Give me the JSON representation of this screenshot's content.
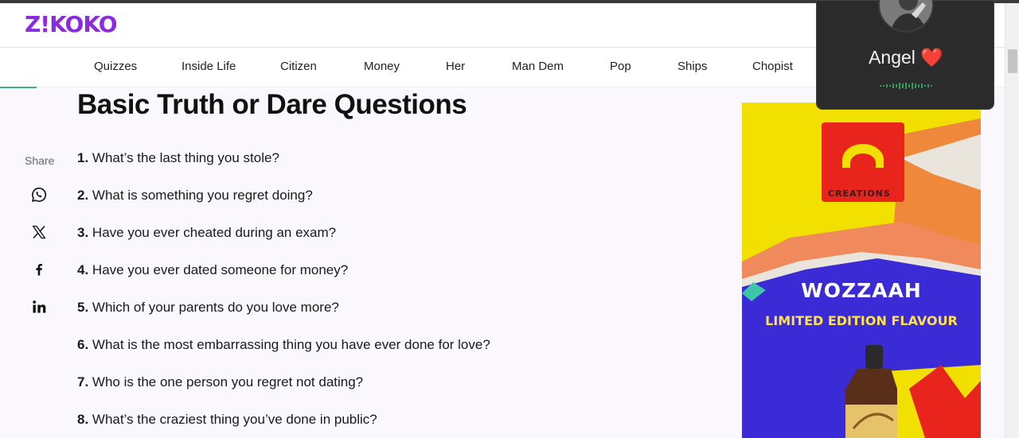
{
  "site": {
    "logo": "Z!KOKO"
  },
  "nav": {
    "items": [
      "Quizzes",
      "Inside Life",
      "Citizen",
      "Money",
      "Her",
      "Man Dem",
      "Pop",
      "Ships",
      "Chopist"
    ]
  },
  "article": {
    "title": "Basic Truth or Dare Questions",
    "questions": [
      {
        "num": "1.",
        "text": "What’s the last thing you stole?"
      },
      {
        "num": "2.",
        "text": "What is something you regret doing?"
      },
      {
        "num": "3.",
        "text": "Have you ever cheated during an exam?"
      },
      {
        "num": "4.",
        "text": "Have you ever dated someone for money?"
      },
      {
        "num": "5.",
        "text": "Which of your parents do you love more?"
      },
      {
        "num": "6.",
        "text": "What is the most embarrassing thing you have ever done for love?"
      },
      {
        "num": "7.",
        "text": "Who is the one person you regret not dating?"
      },
      {
        "num": "8.",
        "text": "What’s the craziest thing you’ve done in public?"
      }
    ]
  },
  "share": {
    "label": "Share",
    "icons": [
      "whatsapp-icon",
      "x-icon",
      "facebook-icon",
      "linkedin-icon"
    ]
  },
  "ad": {
    "brand": "CREATIONS",
    "headline": "WOZZAAH",
    "subline": "LIMITED EDITION FLAVOUR"
  },
  "call_overlay": {
    "name": "Angel",
    "emoji": "❤️"
  },
  "colors": {
    "brand": "#8a2be2",
    "progress": "#3bb08f",
    "ad_yellow": "#f2e100",
    "ad_blue": "#3a2bd6"
  }
}
